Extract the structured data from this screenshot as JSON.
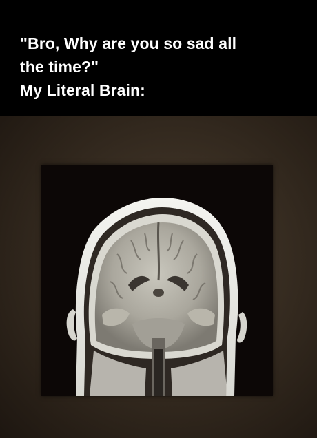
{
  "caption": {
    "line1": "\"Bro, Why are you so sad all",
    "line2": "the time?\"",
    "line3": "My Literal Brain:"
  },
  "colors": {
    "caption_background": "#000000",
    "caption_text": "#ffffff",
    "photo_background": "#3b3024",
    "scan_background": "#0c0706"
  },
  "image": {
    "subject": "mri-coronal-brain-scan"
  }
}
